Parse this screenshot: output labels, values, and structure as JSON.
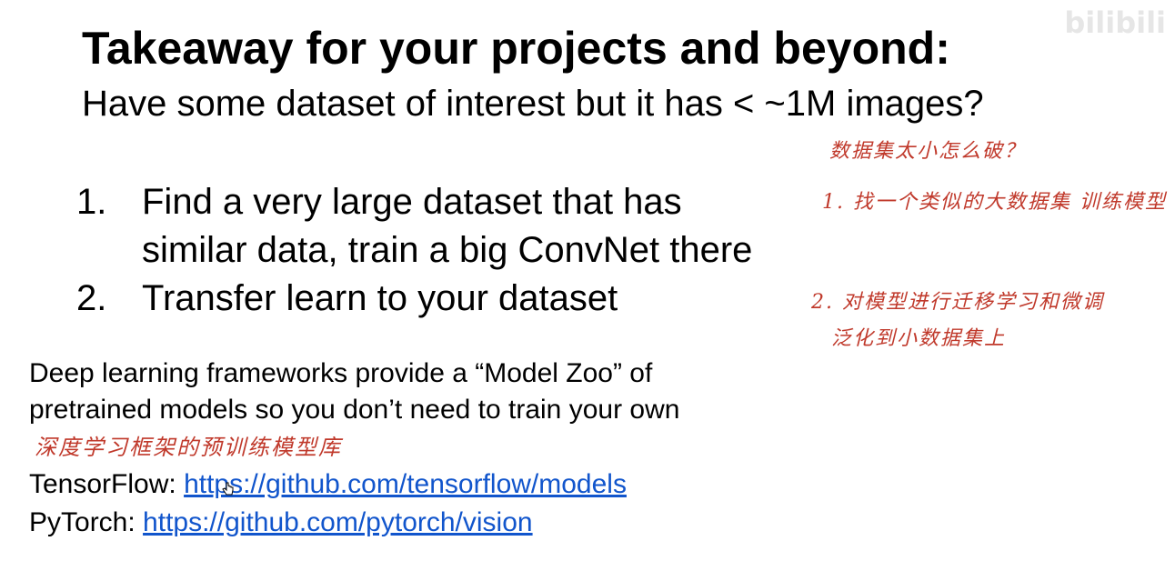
{
  "slide": {
    "title": "Takeaway for your projects and beyond:",
    "subtitle": "Have some dataset of interest but it has < ~1M images?",
    "steps": [
      {
        "num": "1.",
        "line1": "Find a very large dataset that has",
        "line2": "similar data, train a big ConvNet there"
      },
      {
        "num": "2.",
        "line1": "Transfer learn to your dataset"
      }
    ],
    "zoo_line1": "Deep learning frameworks provide a “Model Zoo” of",
    "zoo_line2": "pretrained models so you don’t need to train your own",
    "links": [
      {
        "label": "TensorFlow: ",
        "url": "https://github.com/tensorflow/models"
      },
      {
        "label": "PyTorch: ",
        "url": "https://github.com/pytorch/vision"
      }
    ]
  },
  "annotations": {
    "note1": "数据集太小怎么破？",
    "note2": "1. 找一个类似的大数据集 训练模型",
    "note3": "2. 对模型进行迁移学习和微调",
    "note4": "泛化到小数据集上",
    "note5": "深度学习框架的预训练模型库"
  },
  "watermark": "bilibili",
  "colors": {
    "link": "#1155cc",
    "annotation": "#c0392b"
  }
}
